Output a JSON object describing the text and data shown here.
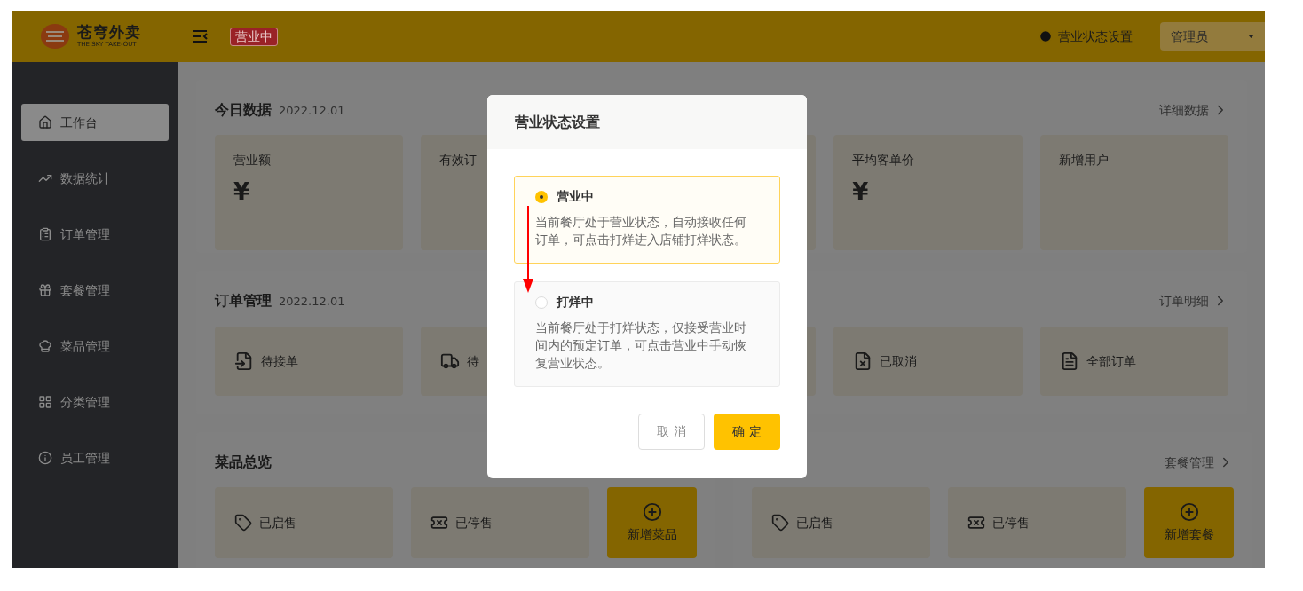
{
  "header": {
    "logo": {
      "name": "苍穹外卖",
      "subtitle": "THE SKY TAKE-OUT"
    },
    "status_badge": "营业中",
    "status_link": "营业状态设置",
    "user_menu": "管理员"
  },
  "sidebar": {
    "items": [
      {
        "label": "工作台",
        "selected": true
      },
      {
        "label": "数据统计",
        "selected": false
      },
      {
        "label": "订单管理",
        "selected": false
      },
      {
        "label": "套餐管理",
        "selected": false
      },
      {
        "label": "菜品管理",
        "selected": false
      },
      {
        "label": "分类管理",
        "selected": false
      },
      {
        "label": "员工管理",
        "selected": false
      }
    ]
  },
  "today": {
    "title": "今日数据",
    "date": "2022.12.01",
    "link": "详细数据",
    "tiles": [
      {
        "label": "营业额",
        "value": "¥"
      },
      {
        "label": "有效订"
      },
      {
        "label": "平均客单价",
        "value": "¥"
      },
      {
        "label": "新增用户"
      }
    ]
  },
  "orders": {
    "title": "订单管理",
    "date": "2022.12.01",
    "link": "订单明细",
    "tiles": [
      {
        "label": "待接单"
      },
      {
        "label": "待"
      },
      {
        "label": "已取消"
      },
      {
        "label": "全部订单"
      }
    ]
  },
  "dishes": {
    "title": "菜品总览",
    "tiles": [
      {
        "label": "已启售"
      },
      {
        "label": "已停售"
      }
    ],
    "add_button": "新增菜品"
  },
  "combos": {
    "link": "套餐管理",
    "tiles": [
      {
        "label": "已启售"
      },
      {
        "label": "已停售"
      }
    ],
    "add_button": "新增套餐"
  },
  "dialog": {
    "title": "营业状态设置",
    "options": [
      {
        "label": "营业中",
        "description": "当前餐厅处于营业状态，自动接收任何订单，可点击打烊进入店铺打烊状态。",
        "selected": true
      },
      {
        "label": "打烊中",
        "description": "当前餐厅处于打烊状态，仅接受营业时间内的预定订单，可点击营业中手动恢复营业状态。",
        "selected": false
      }
    ],
    "cancel": "取 消",
    "confirm": "确 定"
  }
}
